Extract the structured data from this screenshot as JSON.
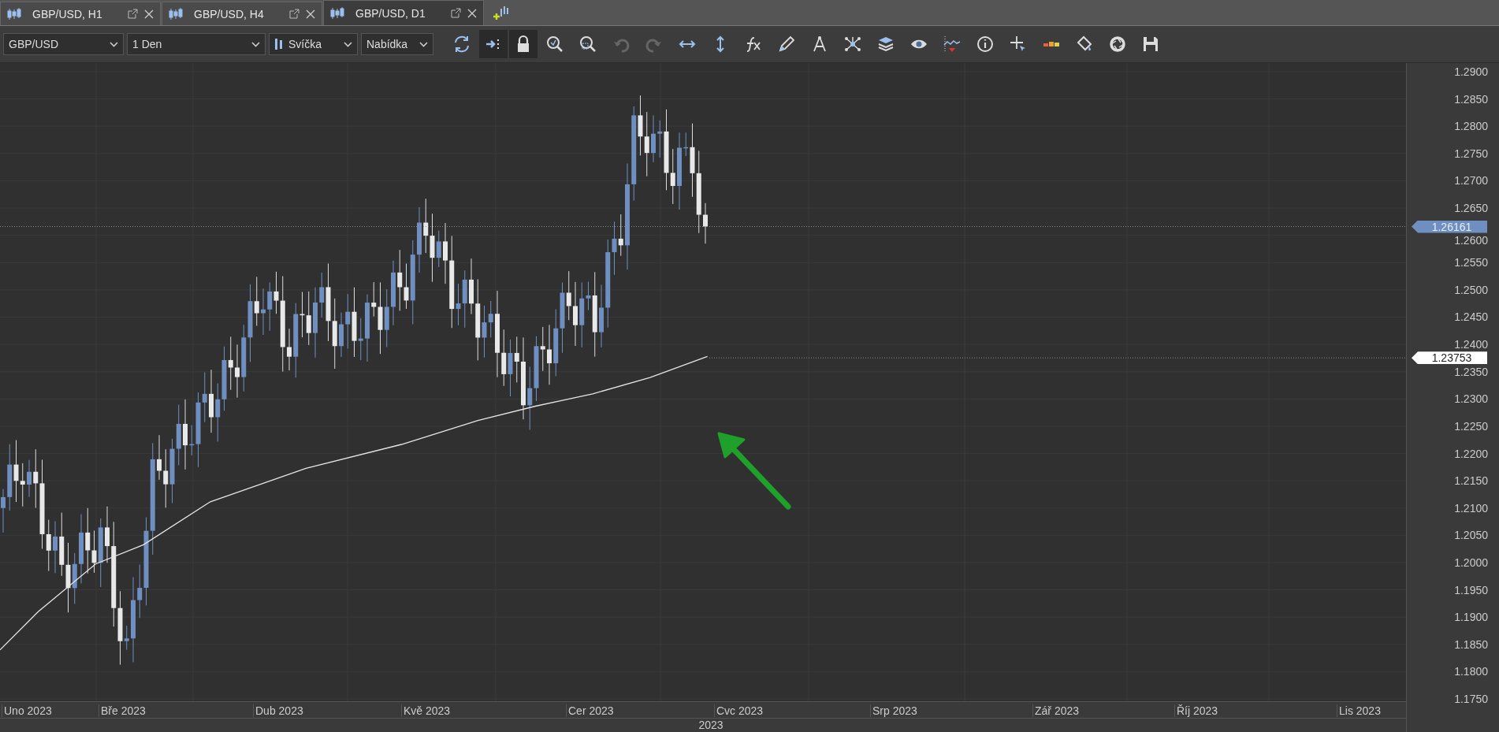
{
  "tabs": [
    {
      "label": "GBP/USD, H1",
      "selected": false
    },
    {
      "label": "GBP/USD, H4",
      "selected": false
    },
    {
      "label": "GBP/USD, D1",
      "selected": true
    }
  ],
  "toolbar": {
    "symbol": "GBP/USD",
    "period": "1 Den",
    "chart_type": "Svíčka",
    "price_type": "Nabídka",
    "auto_scroll": true,
    "locked": true,
    "undo_enabled": false,
    "redo_enabled": false
  },
  "y_axis": {
    "labels": [
      "1.2900",
      "1.2850",
      "1.2800",
      "1.2750",
      "1.2700",
      "1.2650",
      "1.2600",
      "1.2550",
      "1.2500",
      "1.2450",
      "1.2400",
      "1.2350",
      "1.2300",
      "1.2250",
      "1.2200",
      "1.2150",
      "1.2100",
      "1.2050",
      "1.2000",
      "1.1950",
      "1.1900",
      "1.1850",
      "1.1800",
      "1.1750"
    ]
  },
  "price_markers": [
    {
      "kind": "bid",
      "label": "1.26161"
    },
    {
      "kind": "indicator",
      "label": "1.23753"
    }
  ],
  "x_axis": {
    "labels": [
      "Uno 2023",
      "Bře 2023",
      "Dub 2023",
      "Kvě 2023",
      "Cer 2023",
      "Cvc 2023",
      "Srp 2023",
      "Zář 2023",
      "Říj 2023",
      "Lis 2023"
    ],
    "year": "2023"
  }
}
